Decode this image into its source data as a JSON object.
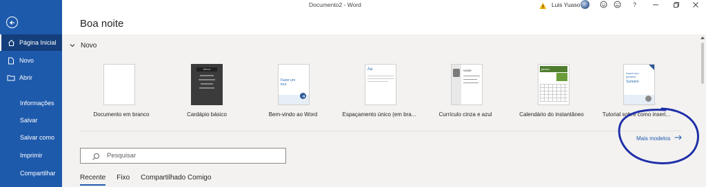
{
  "window": {
    "title": "Documento2 - Word"
  },
  "titlebar": {
    "user_name": "Luis Yuaso",
    "help": "?"
  },
  "greeting": "Boa noite",
  "sidebar": {
    "items": [
      {
        "label": "Página Inicial",
        "icon": "home-icon"
      },
      {
        "label": "Novo",
        "icon": "new-doc-icon"
      },
      {
        "label": "Abrir",
        "icon": "folder-icon"
      },
      {
        "label": "Informações"
      },
      {
        "label": "Salvar"
      },
      {
        "label": "Salvar como"
      },
      {
        "label": "Imprimir"
      },
      {
        "label": "Compartilhar"
      }
    ]
  },
  "novo": {
    "header": "Novo"
  },
  "templates": [
    {
      "label": "Documento em branco"
    },
    {
      "label": "Cardápio básico",
      "thumb_title": "Menu"
    },
    {
      "label": "Bem-vindo ao Word",
      "thumb_text": "Fazer um tour"
    },
    {
      "label": "Espaçamento único (em bra...",
      "thumb_text": "Aa"
    },
    {
      "label": "Currículo cinza e azul",
      "thumb_text": "NOME"
    },
    {
      "label": "Calendário do instantâneo",
      "thumb_text": "janeiro"
    },
    {
      "label": "Tutorial sobre como inseri...",
      "thumb_text": "Inserir seu primeiro",
      "thumb_subtext": "Sumário"
    }
  ],
  "more_templates": "Mais modelos",
  "search": {
    "placeholder": "Pesquisar"
  },
  "tabs": [
    {
      "label": "Recente"
    },
    {
      "label": "Fixo"
    },
    {
      "label": "Compartilhado Comigo"
    }
  ],
  "colors": {
    "sidebar": "#1e5aac",
    "accent": "#1e5aac",
    "annotation": "#1f2fa8"
  }
}
